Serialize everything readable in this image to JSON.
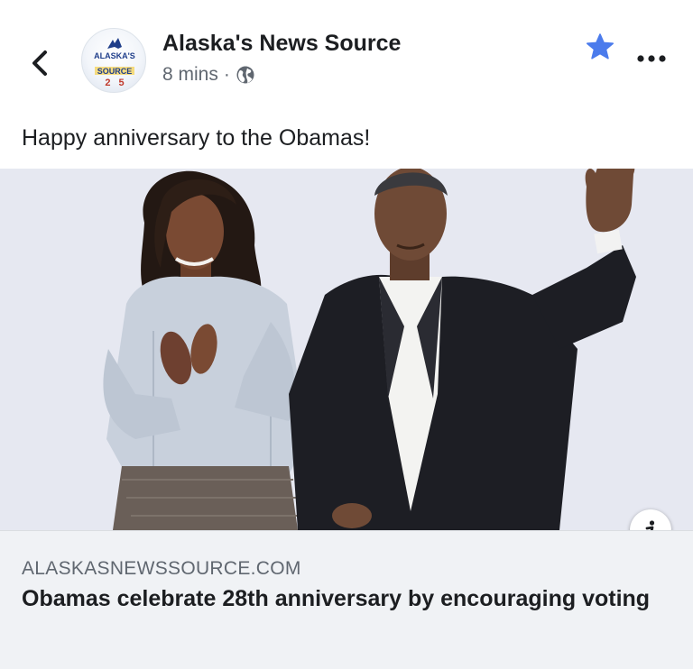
{
  "post": {
    "page_name": "Alaska's News Source",
    "timestamp": "8 mins",
    "separator": "·",
    "privacy_icon": "globe-icon",
    "caption": "Happy anniversary to the Obamas!",
    "avatar": {
      "line1": "ALASKA'S",
      "line2": "SOURCE",
      "line3": "2",
      "line4": "5"
    }
  },
  "link": {
    "domain": "ALASKASNEWSSOURCE.COM",
    "title": "Obamas celebrate 28th anniversary by encouraging voting"
  },
  "icons": {
    "back": "chevron-left-icon",
    "star": "star-icon",
    "more": "more-dots-icon",
    "info": "info-icon"
  },
  "colors": {
    "accent": "#4b7bec",
    "text": "#1c1e21",
    "secondary_text": "#606770",
    "card_bg": "#f0f2f5"
  }
}
